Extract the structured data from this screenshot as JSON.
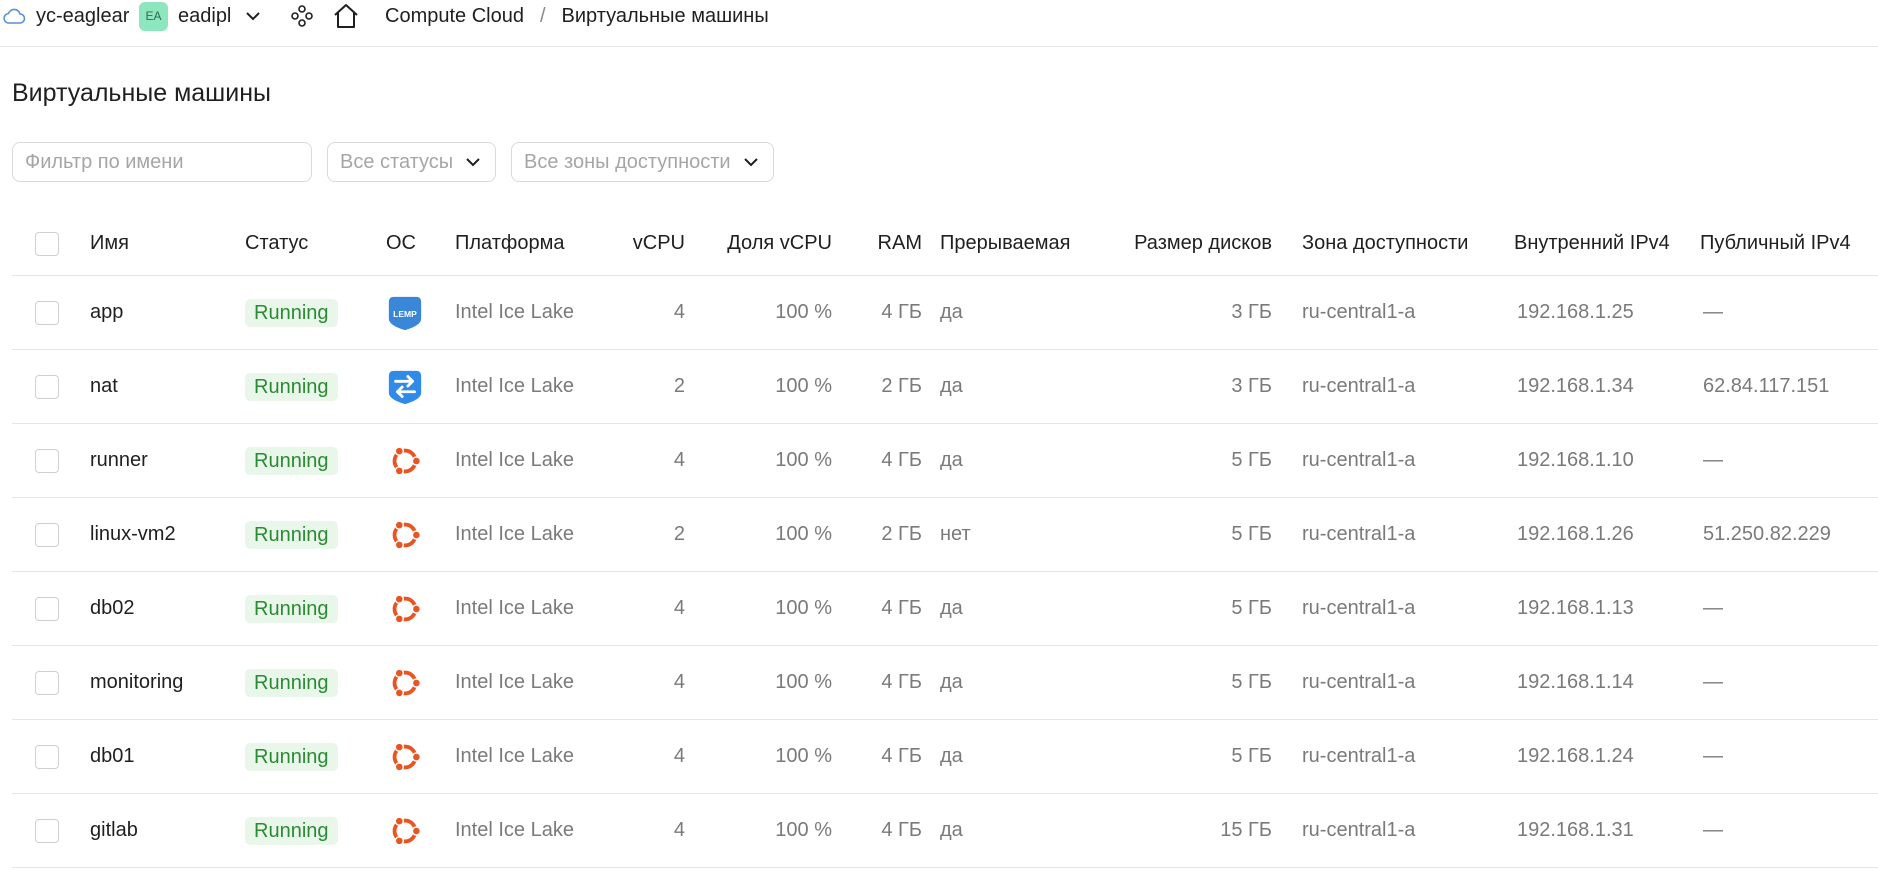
{
  "header": {
    "cloud_name": "yc-eaglear",
    "folder_avatar": "EA",
    "folder_name": "eadipl",
    "breadcrumb": {
      "service": "Compute Cloud",
      "separator": "/",
      "current": "Виртуальные машины"
    }
  },
  "icons": {
    "cloud": "cloud-icon",
    "chevron": "chevron-down-icon",
    "services": "services-icon",
    "home": "home-icon",
    "lemp": "lemp-os-icon",
    "nat": "nat-os-icon",
    "ubuntu": "ubuntu-os-icon"
  },
  "colors": {
    "running_bg": "#e9f7ea",
    "running_text": "#2c8a35",
    "ubuntu": "#e95420",
    "lemp": "#3a86d9",
    "nat": "#2f8ae8",
    "avatar": "#8ee6bf"
  },
  "page": {
    "title": "Виртуальные машины"
  },
  "filters": {
    "name_placeholder": "Фильтр по имени",
    "status": "Все статусы",
    "zone": "Все зоны доступности"
  },
  "table": {
    "columns": [
      "Имя",
      "Статус",
      "ОС",
      "Платформа",
      "vCPU",
      "Доля vCPU",
      "RAM",
      "Прерываемая",
      "Размер дисков",
      "Зона доступности",
      "Внутренний IPv4",
      "Публичный IPv4"
    ],
    "rows": [
      {
        "name": "app",
        "status": "Running",
        "os": "lemp",
        "os_label": "LEMP",
        "platform": "Intel Ice Lake",
        "vcpu": "4",
        "vcpu_share": "100 %",
        "ram": "4 ГБ",
        "preemptible": "да",
        "disk": "3 ГБ",
        "zone": "ru-central1-a",
        "internal_ip": "192.168.1.25",
        "public_ip": "—"
      },
      {
        "name": "nat",
        "status": "Running",
        "os": "nat",
        "os_label": "",
        "platform": "Intel Ice Lake",
        "vcpu": "2",
        "vcpu_share": "100 %",
        "ram": "2 ГБ",
        "preemptible": "да",
        "disk": "3 ГБ",
        "zone": "ru-central1-a",
        "internal_ip": "192.168.1.34",
        "public_ip": "62.84.117.151"
      },
      {
        "name": "runner",
        "status": "Running",
        "os": "ubuntu",
        "os_label": "",
        "platform": "Intel Ice Lake",
        "vcpu": "4",
        "vcpu_share": "100 %",
        "ram": "4 ГБ",
        "preemptible": "да",
        "disk": "5 ГБ",
        "zone": "ru-central1-a",
        "internal_ip": "192.168.1.10",
        "public_ip": "—"
      },
      {
        "name": "linux-vm2",
        "status": "Running",
        "os": "ubuntu",
        "os_label": "",
        "platform": "Intel Ice Lake",
        "vcpu": "2",
        "vcpu_share": "100 %",
        "ram": "2 ГБ",
        "preemptible": "нет",
        "disk": "5 ГБ",
        "zone": "ru-central1-a",
        "internal_ip": "192.168.1.26",
        "public_ip": "51.250.82.229"
      },
      {
        "name": "db02",
        "status": "Running",
        "os": "ubuntu",
        "os_label": "",
        "platform": "Intel Ice Lake",
        "vcpu": "4",
        "vcpu_share": "100 %",
        "ram": "4 ГБ",
        "preemptible": "да",
        "disk": "5 ГБ",
        "zone": "ru-central1-a",
        "internal_ip": "192.168.1.13",
        "public_ip": "—"
      },
      {
        "name": "monitoring",
        "status": "Running",
        "os": "ubuntu",
        "os_label": "",
        "platform": "Intel Ice Lake",
        "vcpu": "4",
        "vcpu_share": "100 %",
        "ram": "4 ГБ",
        "preemptible": "да",
        "disk": "5 ГБ",
        "zone": "ru-central1-a",
        "internal_ip": "192.168.1.14",
        "public_ip": "—"
      },
      {
        "name": "db01",
        "status": "Running",
        "os": "ubuntu",
        "os_label": "",
        "platform": "Intel Ice Lake",
        "vcpu": "4",
        "vcpu_share": "100 %",
        "ram": "4 ГБ",
        "preemptible": "да",
        "disk": "5 ГБ",
        "zone": "ru-central1-a",
        "internal_ip": "192.168.1.24",
        "public_ip": "—"
      },
      {
        "name": "gitlab",
        "status": "Running",
        "os": "ubuntu",
        "os_label": "",
        "platform": "Intel Ice Lake",
        "vcpu": "4",
        "vcpu_share": "100 %",
        "ram": "4 ГБ",
        "preemptible": "да",
        "disk": "15 ГБ",
        "zone": "ru-central1-a",
        "internal_ip": "192.168.1.31",
        "public_ip": "—"
      }
    ]
  }
}
